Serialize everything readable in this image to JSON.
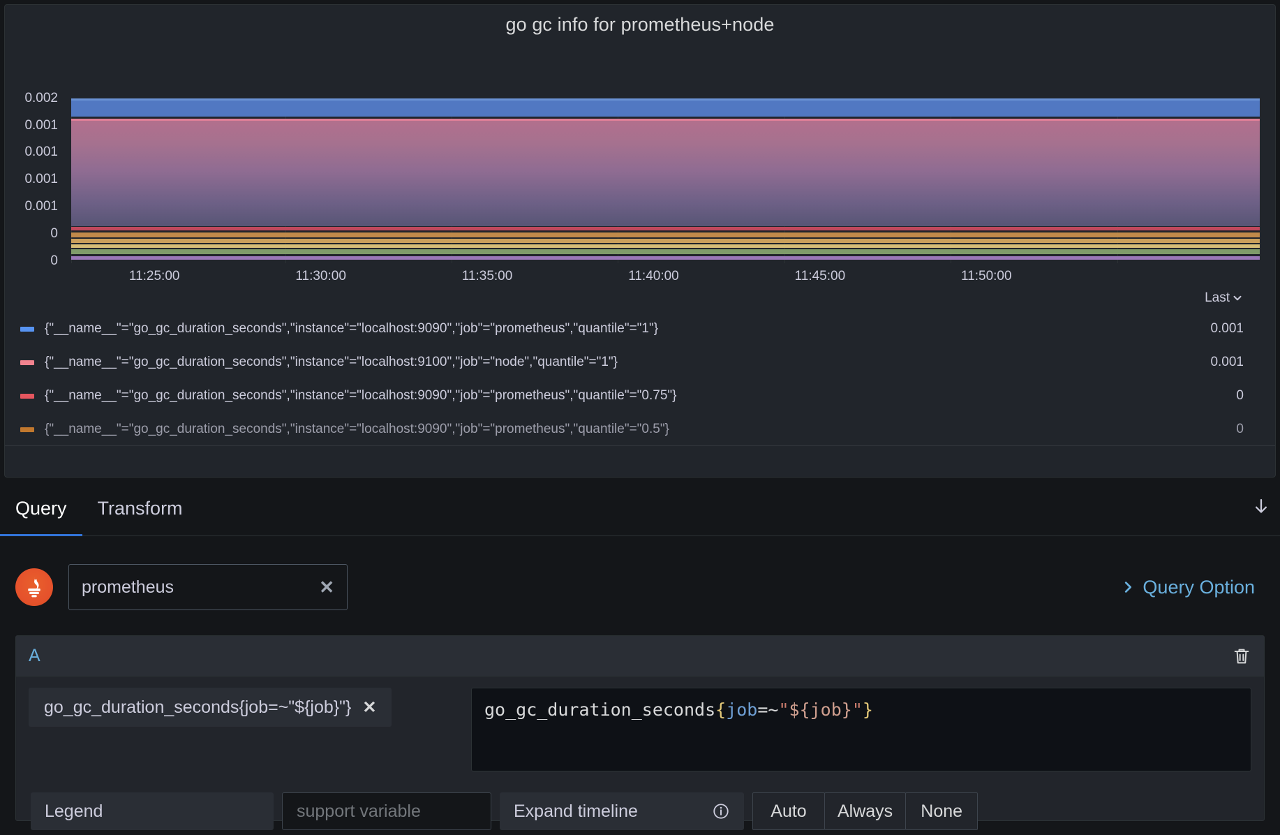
{
  "panel": {
    "title": "go gc info for prometheus+node"
  },
  "chart_data": {
    "type": "area",
    "title": "go gc info for prometheus+node",
    "xlabel": "",
    "ylabel": "",
    "grid": true,
    "legend_position": "bottom",
    "ytick_labels": [
      "0.002",
      "0.001",
      "0.001",
      "0.001",
      "0.001",
      "0",
      "0"
    ],
    "ylim": [
      0,
      0.002
    ],
    "xtick_labels": [
      "11:25:00",
      "11:30:00",
      "11:35:00",
      "11:40:00",
      "11:45:00",
      "11:50:00"
    ],
    "series": [
      {
        "name": "{\"__name__\"=\"go_gc_duration_seconds\",\"instance\"=\"localhost:9090\",\"job\"=\"prometheus\",\"quantile\"=\"1\"}",
        "color": "#5794f2",
        "last": "0.001",
        "value": 0.00166
      },
      {
        "name": "{\"__name__\"=\"go_gc_duration_seconds\",\"instance\"=\"localhost:9100\",\"job\"=\"node\",\"quantile\"=\"1\"}",
        "color": "#f2838f",
        "last": "0.001",
        "value": 0.00152
      },
      {
        "name": "{\"__name__\"=\"go_gc_duration_seconds\",\"instance\"=\"localhost:9090\",\"job\"=\"prometheus\",\"quantile\"=\"0.75\"}",
        "color": "#e5565f",
        "last": "0",
        "value": 0.00022
      },
      {
        "name": "{\"__name__\"=\"go_gc_duration_seconds\",\"instance\"=\"localhost:9090\",\"job\"=\"prometheus\",\"quantile\"=\"0.5\"}",
        "color": "#ff9830",
        "last": "0",
        "value": 0.00018
      }
    ]
  },
  "legend": {
    "header_label": "Last",
    "sort_icon": "chevron-down-icon"
  },
  "tabs": {
    "items": [
      {
        "label": "Query",
        "active": true
      },
      {
        "label": "Transform",
        "active": false
      }
    ],
    "collapse_icon": "arrow-down-icon"
  },
  "datasource": {
    "logo": "prometheus-logo-icon",
    "value": "prometheus",
    "clear_icon": "close-icon",
    "query_option_label": "Query Option",
    "query_option_icon": "chevron-right-icon"
  },
  "query": {
    "ref_id": "A",
    "delete_icon": "trash-icon",
    "metric_pill": "go_gc_duration_seconds{job=~\"${job}\"}",
    "metric_pill_remove_icon": "close-icon",
    "expression": {
      "metric": "go_gc_duration_seconds",
      "open_brace": "{",
      "label": "job",
      "operator": "=~",
      "quote_open": "\"",
      "variable": "${job}",
      "quote_close": "\"",
      "close_brace": "}"
    }
  },
  "options": {
    "legend_label": "Legend",
    "legend_placeholder": "support variable",
    "legend_value": "",
    "expand_timeline_label": "Expand timeline",
    "info_icon": "info-circle-icon",
    "modes": [
      "Auto",
      "Always",
      "None"
    ]
  }
}
